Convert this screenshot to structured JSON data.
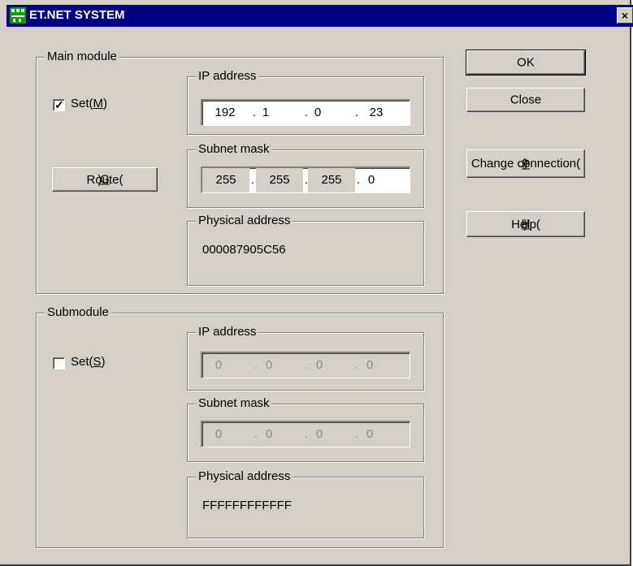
{
  "window": {
    "title": "ET.NET SYSTEM",
    "close_glyph": "×"
  },
  "main_module": {
    "label": "Main module",
    "set_label": "Set(",
    "set_mnemonic": "M",
    "set_checked": true,
    "route_label": "Route(",
    "route_mnemonic": "G",
    "route_suffix": ")...",
    "ip": {
      "label": "IP address",
      "octets": [
        "192",
        "1",
        "0",
        "23"
      ]
    },
    "subnet": {
      "label": "Subnet mask",
      "octets": [
        "255",
        "255",
        "255",
        "0"
      ]
    },
    "physical": {
      "label": "Physical address",
      "value": "000087905C56"
    }
  },
  "submodule": {
    "label": "Submodule",
    "set_label": "Set(",
    "set_mnemonic": "S",
    "set_checked": false,
    "ip": {
      "label": "IP address",
      "octets": [
        "0",
        "0",
        "0",
        "0"
      ]
    },
    "subnet": {
      "label": "Subnet mask",
      "octets": [
        "0",
        "0",
        "0",
        "0"
      ]
    },
    "physical": {
      "label": "Physical address",
      "value": "FFFFFFFFFFFF"
    }
  },
  "buttons": {
    "ok": "OK",
    "close": "Close",
    "change_connection": "Change connection(",
    "change_connection_mnemonic": "P",
    "help": "Help(",
    "help_mnemonic": "H",
    "paren_close": ")"
  },
  "colors": {
    "titlebar": "#000080",
    "face": "#d4d0c8",
    "icon": "#00a000"
  }
}
